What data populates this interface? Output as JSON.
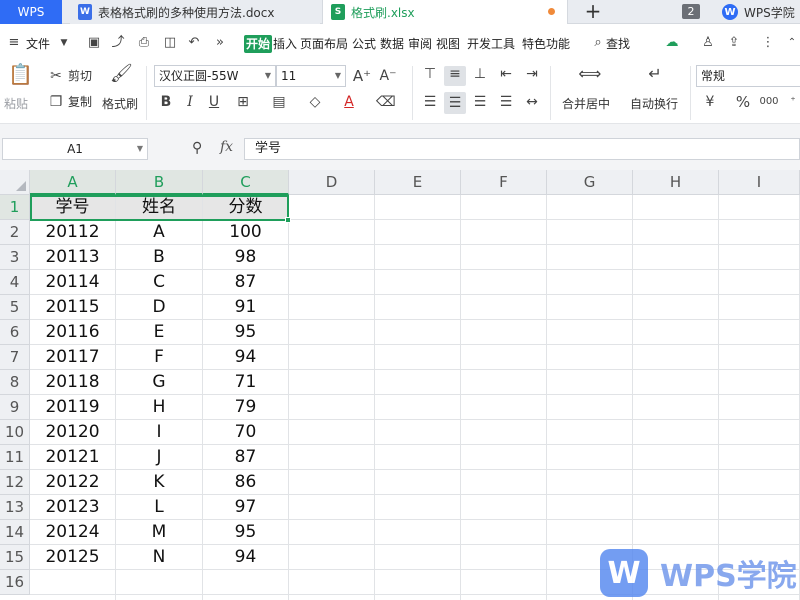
{
  "tabbar": {
    "home": "WPS",
    "doc_tab": "表格格式刷的多种使用方法.docx",
    "xls_tab": "格式刷.xlsx",
    "window_count": "2",
    "academy": "WPS学院"
  },
  "menubar": {
    "file": "文件",
    "more": "»",
    "items": [
      "开始",
      "插入",
      "页面布局",
      "公式",
      "数据",
      "审阅",
      "视图",
      "开发工具",
      "特色功能"
    ],
    "search": "查找"
  },
  "ribbon": {
    "paste": "粘贴",
    "cut": "剪切",
    "copy": "复制",
    "format_painter": "格式刷",
    "font_name": "汉仪正圆-55W",
    "font_size": "11",
    "merge_center": "合并居中",
    "wrap_text": "自动换行",
    "number_format": "常规",
    "percent": "%",
    "bold": "B",
    "italic": "I",
    "underline": "U",
    "font_color": "A",
    "increase_font": "A⁺",
    "decrease_font": "A⁻",
    "thousands": "000"
  },
  "formula_bar": {
    "cell_ref": "A1",
    "fx": "fx",
    "content": "学号"
  },
  "grid": {
    "columns": [
      "A",
      "B",
      "C",
      "D",
      "E",
      "F",
      "G",
      "H",
      "I"
    ],
    "rows": [
      "1",
      "2",
      "3",
      "4",
      "5",
      "6",
      "7",
      "8",
      "9",
      "10",
      "11",
      "12",
      "13",
      "14",
      "15",
      "16"
    ],
    "header": [
      "学号",
      "姓名",
      "分数"
    ],
    "data": [
      [
        "20112",
        "A",
        "100"
      ],
      [
        "20113",
        "B",
        "98"
      ],
      [
        "20114",
        "C",
        "87"
      ],
      [
        "20115",
        "D",
        "91"
      ],
      [
        "20116",
        "E",
        "95"
      ],
      [
        "20117",
        "F",
        "94"
      ],
      [
        "20118",
        "G",
        "71"
      ],
      [
        "20119",
        "H",
        "79"
      ],
      [
        "20120",
        "I",
        "70"
      ],
      [
        "20121",
        "J",
        "87"
      ],
      [
        "20122",
        "K",
        "86"
      ],
      [
        "20123",
        "L",
        "97"
      ],
      [
        "20124",
        "M",
        "95"
      ],
      [
        "20125",
        "N",
        "94"
      ]
    ]
  },
  "watermark": {
    "text": "WPS学院"
  },
  "colors": {
    "accent_green": "#1f9e5b",
    "wps_blue": "#2f6cf5",
    "header_gray": "#e6e6e6"
  }
}
